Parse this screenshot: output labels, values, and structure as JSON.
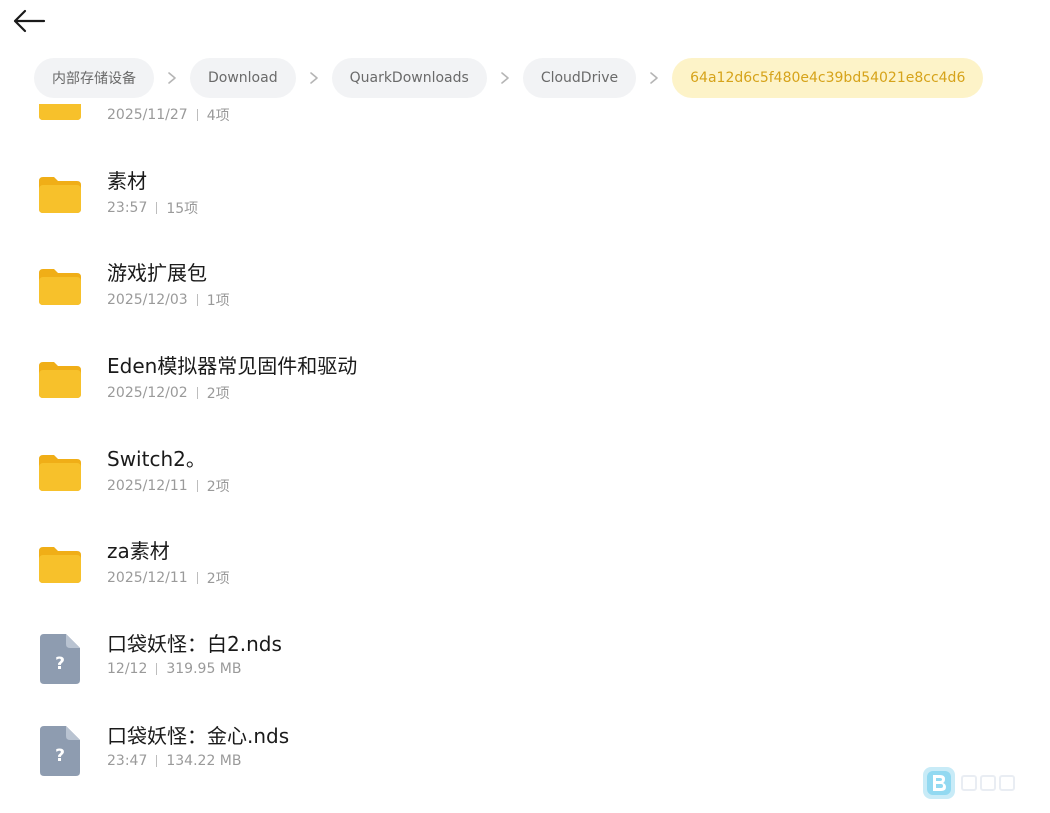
{
  "breadcrumb": {
    "items": [
      {
        "label": "内部存储设备"
      },
      {
        "label": "Download"
      },
      {
        "label": "QuarkDownloads"
      },
      {
        "label": "CloudDrive"
      },
      {
        "label": "64a12d6c5f480e4c39bd54021e8cc4d6"
      }
    ]
  },
  "files": [
    {
      "name": "",
      "date": "2025/11/27",
      "detail": "4项",
      "type": "folder"
    },
    {
      "name": "素材",
      "date": "23:57",
      "detail": "15项",
      "type": "folder"
    },
    {
      "name": "游戏扩展包",
      "date": "2025/12/03",
      "detail": "1项",
      "type": "folder"
    },
    {
      "name": "Eden模拟器常见固件和驱动",
      "date": "2025/12/02",
      "detail": "2项",
      "type": "folder"
    },
    {
      "name": "Switch2。",
      "date": "2025/12/11",
      "detail": "2项",
      "type": "folder"
    },
    {
      "name": "za素材",
      "date": "2025/12/11",
      "detail": "2项",
      "type": "folder"
    },
    {
      "name": "口袋妖怪：白2.nds",
      "date": "12/12",
      "detail": "319.95 MB",
      "type": "unknown-file"
    },
    {
      "name": "口袋妖怪：金心.nds",
      "date": "23:47",
      "detail": "134.22 MB",
      "type": "unknown-file"
    }
  ],
  "icons": {
    "back": "arrow-left-icon",
    "separator": "chevron-right-icon",
    "folder": "folder-icon",
    "unknown_file": "unknown-file-icon",
    "unknown_glyph": "?"
  },
  "colors": {
    "folder": "#f7c12b",
    "folder_tab": "#f0ae17",
    "file": "#8e9cb0",
    "active_crumb_bg": "#fdf3c8",
    "active_crumb_text": "#d6a31a"
  }
}
